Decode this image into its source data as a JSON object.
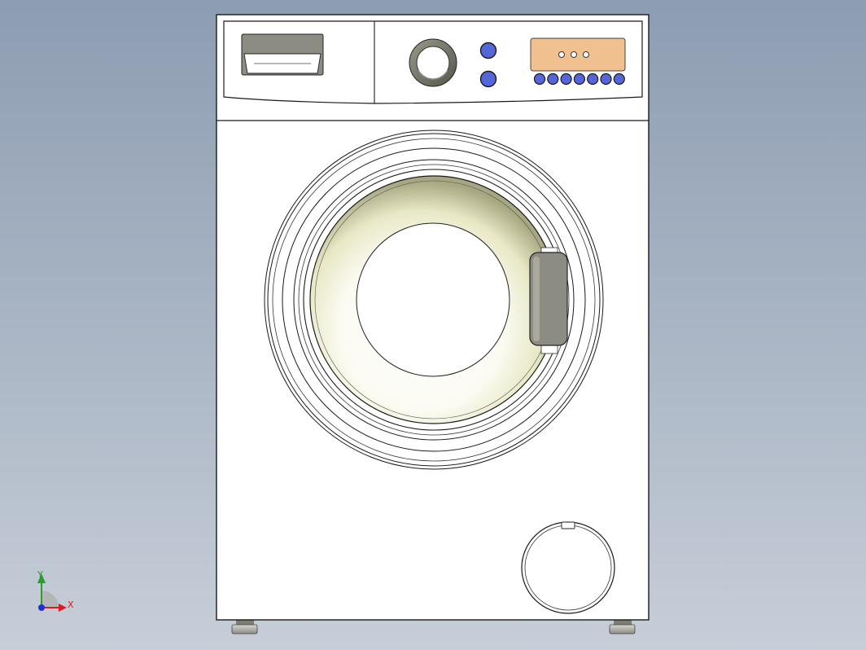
{
  "viewport": {
    "background_top": "#8d9db2",
    "background_bottom": "#c7ced8",
    "model": "washing-machine",
    "view": "front"
  },
  "display_panel": {
    "color": "#f0c08e",
    "indicator_lights": 3
  },
  "buttons": {
    "color": "#5566d8",
    "side_buttons": 2,
    "row_buttons": 7
  },
  "door_handle": {
    "color": "#8c8c82"
  },
  "axis_triad": {
    "x_label": "X",
    "y_label": "Y",
    "x_color": "#d81e1e",
    "y_color": "#2a9d2a",
    "z_color": "#1b2fd6"
  }
}
